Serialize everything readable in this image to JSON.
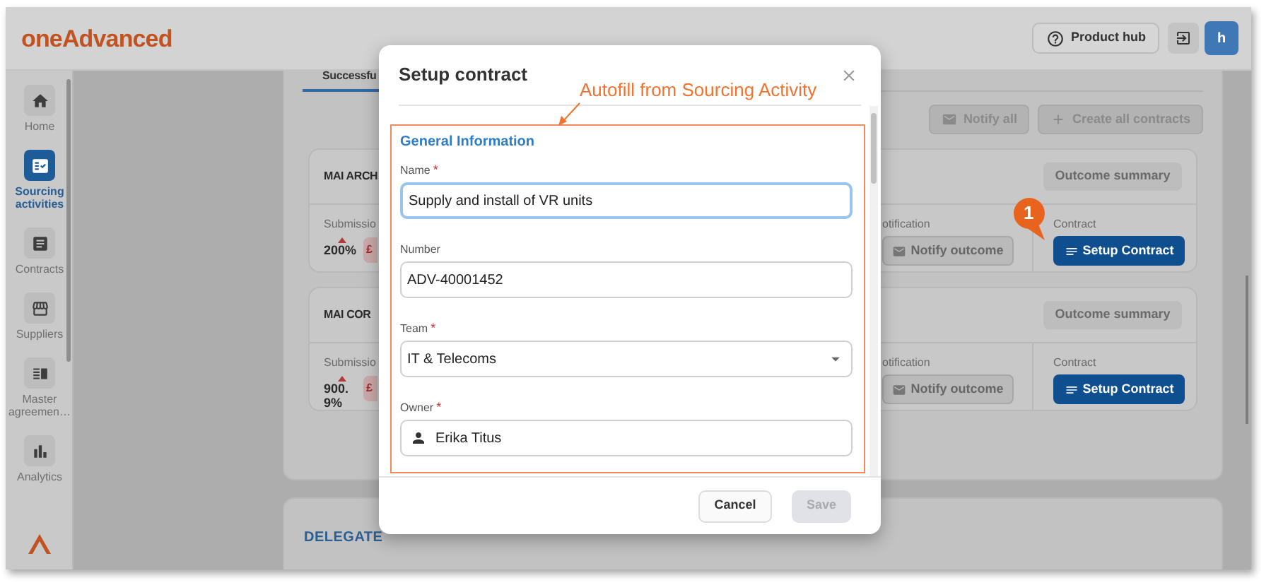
{
  "header": {
    "logo": "oneAdvanced",
    "product_hub": "Product hub",
    "avatar": "h"
  },
  "sidebar": {
    "items": [
      {
        "label": "Home",
        "selected": false
      },
      {
        "label": "Sourcing activities",
        "selected": true
      },
      {
        "label": "Contracts",
        "selected": false
      },
      {
        "label": "Suppliers",
        "selected": false
      },
      {
        "label": "Master agreemen…",
        "selected": false
      },
      {
        "label": "Analytics",
        "selected": false
      }
    ]
  },
  "tabs": [
    {
      "label": "Successfu",
      "selected": true
    }
  ],
  "toolbar": [
    {
      "label": "Notify all",
      "kind": "mail"
    },
    {
      "label": "Create all contracts",
      "kind": "add"
    }
  ],
  "cards": [
    {
      "title": "MAI ARCH",
      "outcome_button": "Outcome summary",
      "submission_label": "Submissio",
      "submission_value": "200%",
      "amount_badge": "£",
      "notification_label": "otification",
      "notify_button": "Notify outcome",
      "contract_label": "Contract",
      "contract_button": "Setup Contract"
    },
    {
      "title": "MAI COR",
      "outcome_button": "Outcome summary",
      "submission_label": "Submissio",
      "submission_value": "900.9%",
      "amount_badge": "£",
      "notification_label": "otification",
      "notify_button": "Notify outcome",
      "contract_label": "Contract",
      "contract_button": "Setup Contract"
    }
  ],
  "delegate_heading": "DELEGATE",
  "modal": {
    "title": "Setup contract",
    "section": "General Information",
    "fields": [
      {
        "label": "Name",
        "required_mark": "*",
        "value": "Supply and install of VR units",
        "kind": "text",
        "focused": true
      },
      {
        "label": "Number",
        "value": "ADV-40001452",
        "kind": "text",
        "focused": false
      },
      {
        "label": "Team",
        "required_mark": "*",
        "value": "IT & Telecoms",
        "kind": "select",
        "focused": false
      },
      {
        "label": "Owner",
        "required_mark": "*",
        "value": "Erika Titus",
        "kind": "person",
        "focused": false
      }
    ],
    "buttons": [
      {
        "label": "Cancel",
        "disabled": false
      },
      {
        "label": "Save",
        "disabled": true
      }
    ]
  },
  "annotation": "Autofill from Sourcing Activity",
  "step_badge": "1"
}
